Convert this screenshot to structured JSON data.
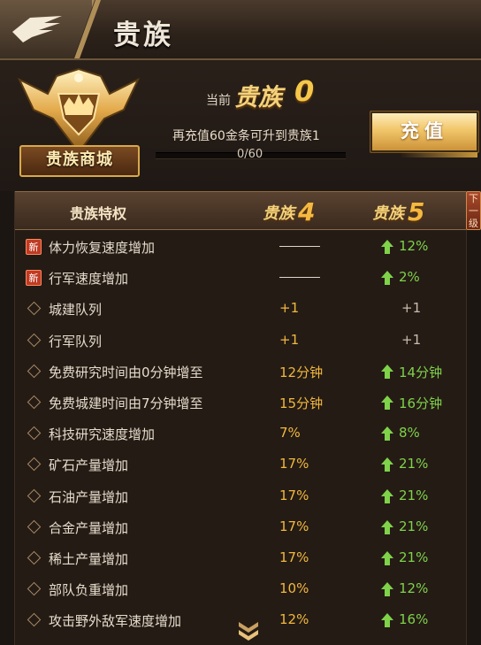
{
  "header": {
    "title": "贵族",
    "back_icon": "eagle-back-icon"
  },
  "status": {
    "current_prefix": "当前",
    "level_label": "贵族",
    "level_value": "0",
    "upgrade_text": "再充值60金条可升到贵族1",
    "progress_text": "0/60",
    "progress_fraction": 0
  },
  "badge": {
    "label": "贵族商城",
    "icon": "crown-emblem-icon"
  },
  "recharge_button": {
    "label": "充值"
  },
  "table": {
    "header_name": "贵族特权",
    "col_a_label": "贵族",
    "col_a_level": "4",
    "col_b_label": "贵族",
    "col_b_level": "5",
    "next_tab": "下一级",
    "rows": [
      {
        "icon": "new-badge-icon",
        "new_text": "新",
        "name": "体力恢复速度增加",
        "v4": "——",
        "v5": "12%",
        "v5_up": true
      },
      {
        "icon": "new-badge-icon",
        "new_text": "新",
        "name": "行军速度增加",
        "v4": "——",
        "v5": "2%",
        "v5_up": true
      },
      {
        "icon": "diamond-bullet-icon",
        "name": "城建队列",
        "v4": "+1",
        "v5": "+1",
        "v5_up": false
      },
      {
        "icon": "diamond-bullet-icon",
        "name": "行军队列",
        "v4": "+1",
        "v5": "+1",
        "v5_up": false
      },
      {
        "icon": "diamond-bullet-icon",
        "name": "免费研究时间由0分钟增至",
        "v4": "12分钟",
        "v5": "14分钟",
        "v5_up": true
      },
      {
        "icon": "diamond-bullet-icon",
        "name": "免费城建时间由7分钟增至",
        "v4": "15分钟",
        "v5": "16分钟",
        "v5_up": true
      },
      {
        "icon": "diamond-bullet-icon",
        "name": "科技研究速度增加",
        "v4": "7%",
        "v5": "8%",
        "v5_up": true
      },
      {
        "icon": "diamond-bullet-icon",
        "name": "矿石产量增加",
        "v4": "17%",
        "v5": "21%",
        "v5_up": true
      },
      {
        "icon": "diamond-bullet-icon",
        "name": "石油产量增加",
        "v4": "17%",
        "v5": "21%",
        "v5_up": true
      },
      {
        "icon": "diamond-bullet-icon",
        "name": "合金产量增加",
        "v4": "17%",
        "v5": "21%",
        "v5_up": true
      },
      {
        "icon": "diamond-bullet-icon",
        "name": "稀土产量增加",
        "v4": "17%",
        "v5": "21%",
        "v5_up": true
      },
      {
        "icon": "diamond-bullet-icon",
        "name": "部队负重增加",
        "v4": "10%",
        "v5": "12%",
        "v5_up": true
      },
      {
        "icon": "diamond-bullet-icon",
        "name": "攻击野外敌军速度增加",
        "v4": "12%",
        "v5": "16%",
        "v5_up": true
      }
    ]
  },
  "colors": {
    "gold": "#f2b83c",
    "green_up": "#7fd24a",
    "background": "#1c1612"
  }
}
